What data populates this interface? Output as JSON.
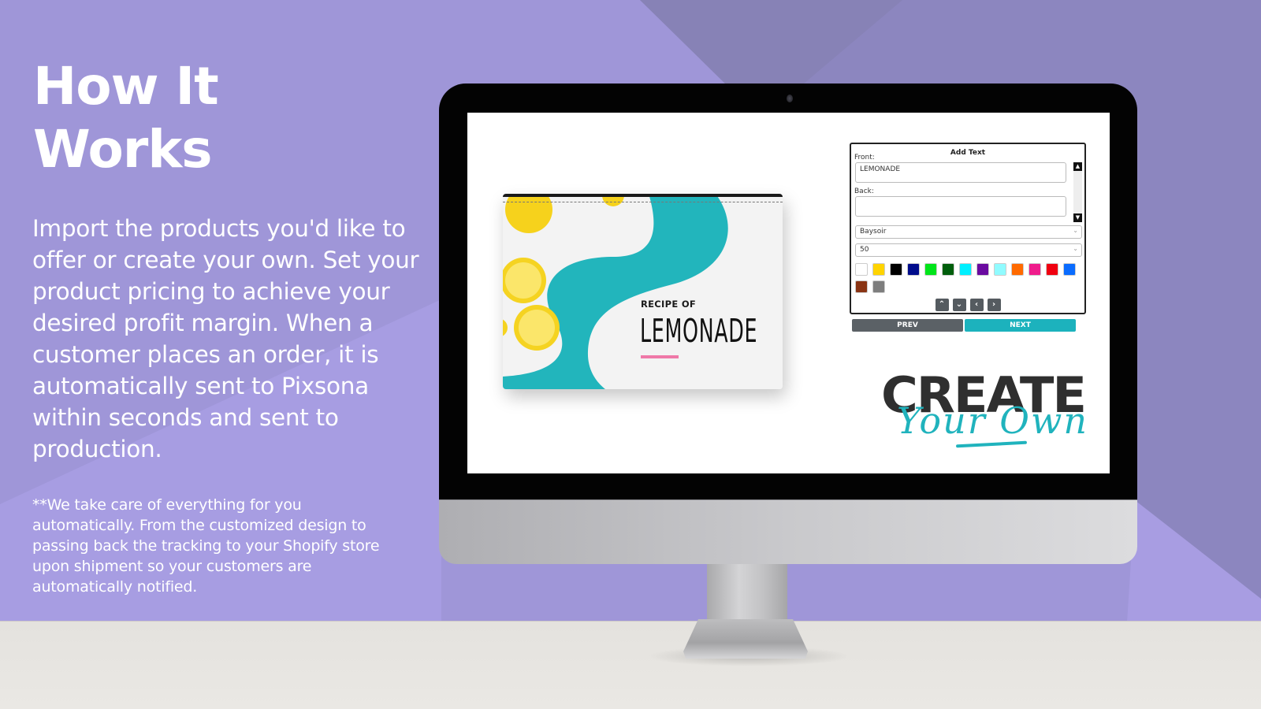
{
  "page": {
    "heading_line1": "How It",
    "heading_line2": "Works",
    "body": "Import the products you'd like to offer or create your own. Set your product pricing to achieve your desired profit margin. When a customer places an order, it is automatically sent to Pixsona within seconds and sent to production.",
    "footnote": "**We take care of everything for you automatically. From the customized design to passing back the tracking to your Shopify store upon shipment so your customers are automatically notified."
  },
  "colors": {
    "background": "#9f96d8",
    "background_dark": "#8a82b8",
    "accent_teal": "#1cb2bd",
    "prev_button": "#5b6166",
    "floor": "#e6e4e0"
  },
  "product": {
    "subtitle": "RECIPE OF",
    "title": "LEMONADE"
  },
  "editor": {
    "title": "Add Text",
    "front_label": "Front:",
    "front_value": "LEMONADE",
    "back_label": "Back:",
    "back_value": "",
    "font_select": "Baysoir",
    "size_select": "50",
    "scroll_up_icon": "▲",
    "scroll_down_icon": "▼",
    "swatches": [
      {
        "name": "white",
        "color": "#ffffff"
      },
      {
        "name": "yellow",
        "color": "#ffd400"
      },
      {
        "name": "black",
        "color": "#000000"
      },
      {
        "name": "navy",
        "color": "#000c8c"
      },
      {
        "name": "green",
        "color": "#00e51a"
      },
      {
        "name": "dark-green",
        "color": "#005e0c"
      },
      {
        "name": "cyan",
        "color": "#00f0ff"
      },
      {
        "name": "purple",
        "color": "#6a0aa0"
      },
      {
        "name": "light-cyan",
        "color": "#90fbff"
      },
      {
        "name": "orange",
        "color": "#ff6a00"
      },
      {
        "name": "pink",
        "color": "#ef1c8c"
      },
      {
        "name": "red",
        "color": "#f00010"
      },
      {
        "name": "blue",
        "color": "#0a6cff"
      },
      {
        "name": "brown",
        "color": "#8a3414"
      },
      {
        "name": "gray",
        "color": "#7e7e7e"
      }
    ],
    "nav": {
      "up": "⌃",
      "down": "⌄",
      "left": "‹",
      "right": "›"
    },
    "prev_label": "PREV",
    "next_label": "NEXT"
  },
  "logo": {
    "create": "CREATE",
    "your_own": "Your Own"
  }
}
